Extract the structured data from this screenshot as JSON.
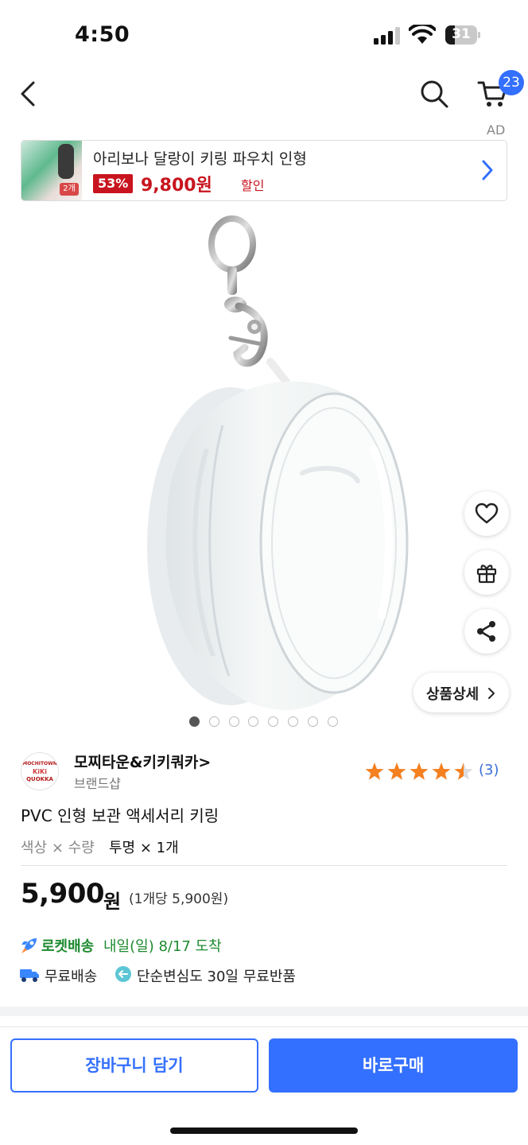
{
  "status": {
    "time": "4:50",
    "battery": "31",
    "battery_level": 0.31
  },
  "nav": {
    "cart_count": "23"
  },
  "ad": {
    "label": "AD",
    "title": "아리보나 달랑이 키링 파우치 인형",
    "discount_pct": "53%",
    "price": "9,800원",
    "discount_text": "할인",
    "thumb_badge": "2개"
  },
  "gallery": {
    "dot_count": 8,
    "active_index": 0,
    "detail_label": "상품상세"
  },
  "brand": {
    "logo_line1": "MOCHITOWN",
    "logo_line2": "KiKi",
    "logo_line3": "QUOKKA",
    "name": "모찌타운&키키쿼카>",
    "subtitle": "브랜드샵",
    "rating": 4.5,
    "review_count": "(3)"
  },
  "product": {
    "title": "PVC 인형 보관 액세서리 키링",
    "option_label": "색상 × 수량",
    "option_value": "투명 × 1개",
    "price": "5,900",
    "price_unit": "원",
    "price_each": "(1개당 5,900원)"
  },
  "delivery": {
    "rocket_label": "로켓배송",
    "rocket_date": "내일(일) 8/17 도착",
    "free_shipping": "무료배송",
    "free_return": "단순변심도 30일 무료반품"
  },
  "actions": {
    "cart_button": "장바구니 담기",
    "buy_button": "바로구매"
  },
  "colors": {
    "accent": "#3470ff",
    "sale": "#c8141e",
    "rocket": "#1d8a2f",
    "star": "#f5801f"
  },
  "icons": {
    "back": "chevron-left-icon",
    "search": "search-icon",
    "cart": "cart-icon",
    "wishlist": "heart-icon",
    "gift": "gift-icon",
    "share": "share-icon",
    "rocket": "rocket-icon",
    "truck": "truck-icon",
    "return": "return-icon"
  }
}
